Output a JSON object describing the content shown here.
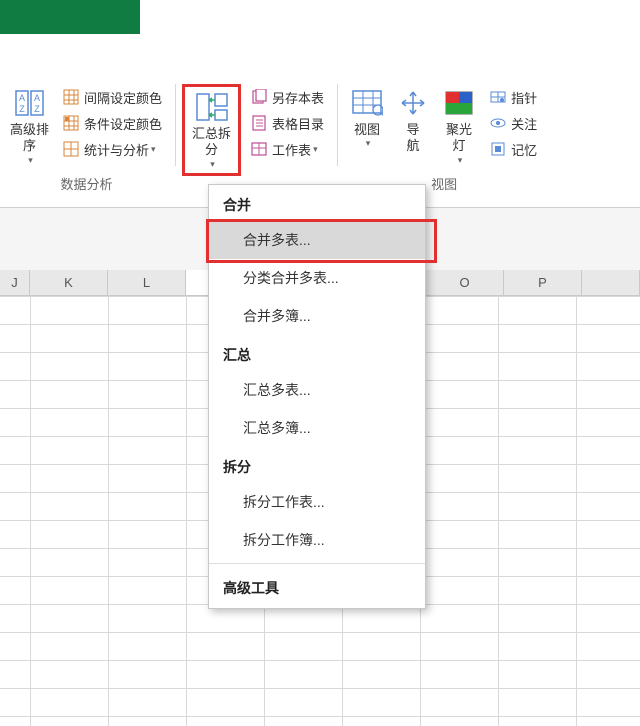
{
  "titlebar": {
    "color": "#107c41"
  },
  "ribbon": {
    "groups": {
      "analysis": {
        "label": "数据分析",
        "adv_sort": "高级排\n序",
        "interval_color": "间隔设定颜色",
        "cond_color": "条件设定颜色",
        "stats_analysis": "统计与分析",
        "split_sum": "汇总拆\n分",
        "save_copy": "另存本表",
        "sheet_toc": "表格目录",
        "worksheet": "工作表"
      },
      "view": {
        "label": "视图",
        "view_btn": "视图",
        "nav_btn": "导\n航",
        "spotlight": "聚光\n灯",
        "pointer": "指针",
        "follow": "关注",
        "memory": "记忆"
      }
    }
  },
  "columns": {
    "J": "J",
    "K": "K",
    "L": "L",
    "O": "O",
    "P": "P"
  },
  "menu": {
    "sec_merge": "合并",
    "merge_multi_sheets": "合并多表...",
    "classify_merge": "分类合并多表...",
    "merge_workbooks": "合并多簿...",
    "sec_sum": "汇总",
    "sum_sheets": "汇总多表...",
    "sum_workbooks": "汇总多簿...",
    "sec_split": "拆分",
    "split_sheets": "拆分工作表...",
    "split_workbooks": "拆分工作簿...",
    "sec_adv": "高级工具"
  }
}
